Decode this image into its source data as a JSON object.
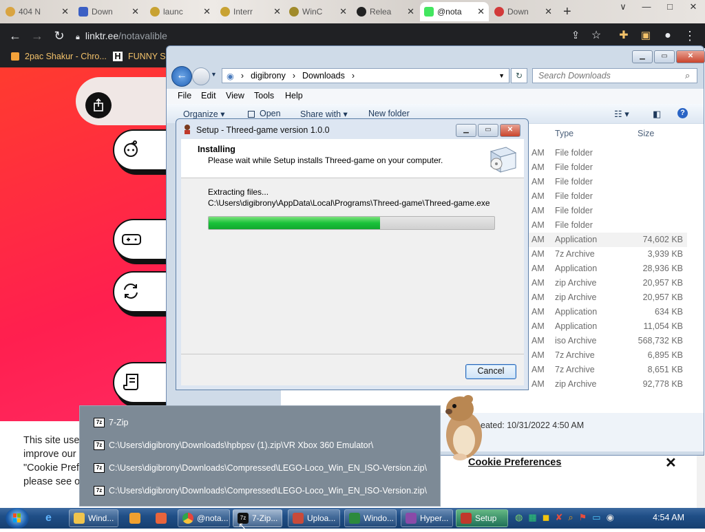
{
  "browser": {
    "tabs": [
      {
        "label": "404 N",
        "color": "#d9a441"
      },
      {
        "label": "Down",
        "color": "#3b5fc4"
      },
      {
        "label": "launc",
        "color": "#c8a232"
      },
      {
        "label": "Interr",
        "color": "#c8a232"
      },
      {
        "label": "WinC",
        "color": "#a08a2a"
      },
      {
        "label": "Relea",
        "color": "#222222"
      },
      {
        "label": "@nota",
        "color": "#43e660"
      },
      {
        "label": "Down",
        "color": "#d23a3a"
      }
    ],
    "new_tab": "+",
    "window_buttons": [
      "∨",
      "—",
      "□",
      "✕"
    ],
    "url_domain": "linktr.ee",
    "url_path": "/notavalible",
    "bookmarks": [
      {
        "label": "2pac Shakur - Chro...",
        "icon": "H-icon"
      },
      {
        "label": "FUNNY SH",
        "icon": "H"
      }
    ]
  },
  "cookie": {
    "text_lines": [
      "This site use",
      "improve our",
      "\"Cookie Pref",
      "please see o"
    ],
    "prefs_link": "Cookie Preferences",
    "close": "✕"
  },
  "explorer": {
    "breadcrumb": [
      "digibrony",
      "Downloads"
    ],
    "search_placeholder": "Search Downloads",
    "menu": [
      "File",
      "Edit",
      "View",
      "Tools",
      "Help"
    ],
    "commands": [
      "Organize ▾",
      "Open",
      "Share with ▾",
      "New folder"
    ],
    "columns": {
      "type": "Type",
      "size": "Size"
    },
    "rows": [
      {
        "time": "AM",
        "type": "File folder",
        "size": ""
      },
      {
        "time": "AM",
        "type": "File folder",
        "size": ""
      },
      {
        "time": "AM",
        "type": "File folder",
        "size": ""
      },
      {
        "time": "AM",
        "type": "File folder",
        "size": ""
      },
      {
        "time": "AM",
        "type": "File folder",
        "size": ""
      },
      {
        "time": "AM",
        "type": "File folder",
        "size": ""
      },
      {
        "time": "AM",
        "type": "Application",
        "size": "74,602 KB"
      },
      {
        "time": "AM",
        "type": "7z Archive",
        "size": "3,939 KB"
      },
      {
        "time": "AM",
        "type": "Application",
        "size": "28,936 KB"
      },
      {
        "time": "AM",
        "type": "zip Archive",
        "size": "20,957 KB"
      },
      {
        "time": "AM",
        "type": "zip Archive",
        "size": "20,957 KB"
      },
      {
        "time": "AM",
        "type": "Application",
        "size": "634 KB"
      },
      {
        "time": "AM",
        "type": "Application",
        "size": "11,054 KB"
      },
      {
        "time": "AM",
        "type": "iso Archive",
        "size": "568,732 KB"
      },
      {
        "time": "AM",
        "type": "7z Archive",
        "size": "6,895 KB"
      },
      {
        "time": "AM",
        "type": "7z Archive",
        "size": "8,651 KB"
      },
      {
        "time": "AM",
        "type": "zip Archive",
        "size": "92,778 KB"
      }
    ],
    "details": "eated:  10/31/2022 4:50 AM"
  },
  "setup": {
    "title": "Setup - Threed-game version 1.0.0",
    "heading": "Installing",
    "subheading": "Please wait while Setup installs Threed-game on your computer.",
    "status": "Extracting files...",
    "path": "C:\\Users\\digibrony\\AppData\\Local\\Programs\\Threed-game\\Threed-game.exe",
    "progress": 0.6,
    "cancel": "Cancel"
  },
  "jumplist": {
    "items": [
      "7-Zip",
      "C:\\Users\\digibrony\\Downloads\\hpbpsv (1).zip\\VR Xbox 360 Emulator\\",
      "C:\\Users\\digibrony\\Downloads\\Compressed\\LEGO-Loco_Win_EN_ISO-Version.zip\\",
      "C:\\Users\\digibrony\\Downloads\\Compressed\\LEGO-Loco_Win_EN_ISO-Version.zip\\"
    ]
  },
  "taskbar": {
    "items": [
      {
        "label": "Wind...",
        "color": "#f0c44c"
      },
      {
        "label": "@nota...",
        "color": "#e8453c"
      },
      {
        "label": "7-Zip...",
        "color": "#111111"
      },
      {
        "label": "Uploa...",
        "color": "#c94a3a"
      },
      {
        "label": "Windo...",
        "color": "#2c8a3c"
      },
      {
        "label": "Hyper...",
        "color": "#8a4aa8"
      },
      {
        "label": "Setup",
        "color": "#c0392b"
      }
    ],
    "clock": "4:54 AM"
  }
}
